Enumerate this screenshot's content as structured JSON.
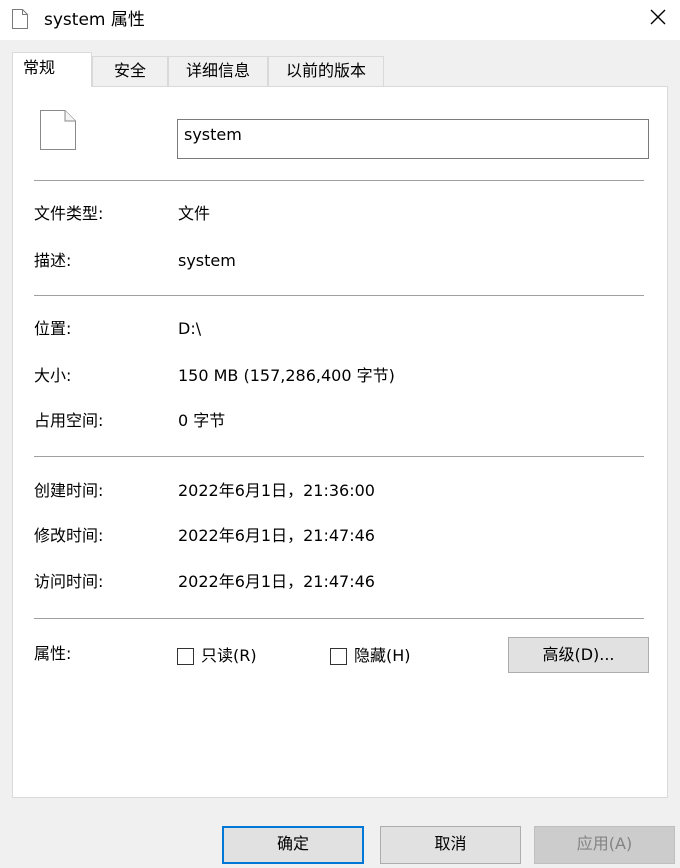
{
  "window": {
    "title": "system 属性",
    "icon": "file-icon",
    "close_icon": "close-icon"
  },
  "tabs": [
    {
      "label": "常规",
      "active": true
    },
    {
      "label": "安全",
      "active": false
    },
    {
      "label": "详细信息",
      "active": false
    },
    {
      "label": "以前的版本",
      "active": false
    }
  ],
  "general": {
    "file_icon": "file-icon",
    "file_name": "system",
    "file_type_label": "文件类型:",
    "file_type_value": "文件",
    "description_label": "描述:",
    "description_value": "system",
    "location_label": "位置:",
    "location_value": "D:\\",
    "size_label": "大小:",
    "size_value": "150 MB (157,286,400 字节)",
    "size_on_disk_label": "占用空间:",
    "size_on_disk_value": "0 字节",
    "created_label": "创建时间:",
    "created_value": "2022年6月1日，21:36:00",
    "modified_label": "修改时间:",
    "modified_value": "2022年6月1日，21:47:46",
    "accessed_label": "访问时间:",
    "accessed_value": "2022年6月1日，21:47:46",
    "attributes_label": "属性:",
    "readonly_label": "只读(R)",
    "readonly_checked": false,
    "hidden_label": "隐藏(H)",
    "hidden_checked": false,
    "advanced_button": "高级(D)..."
  },
  "footer": {
    "ok_label": "确定",
    "cancel_label": "取消",
    "apply_label": "应用(A)"
  }
}
